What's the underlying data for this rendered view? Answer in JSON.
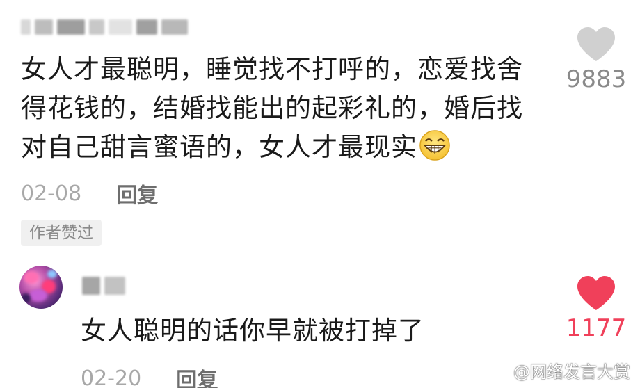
{
  "comments": [
    {
      "text": "女人才最聪明，睡觉找不打呼的，恋爱找舍\n得花钱的，结婚找能出的起彩礼的，婚后找\n对自己甜言蜜语的，女人才最现实",
      "emoji": "grinning-face-emoji",
      "date": "02-08",
      "reply_label": "回复",
      "badge": "作者赞过",
      "likes": "9883",
      "liked": false
    },
    {
      "text": "女人聪明的话你早就被打掉了",
      "date": "02-20",
      "reply_label": "回复",
      "likes": "1177",
      "liked": true
    }
  ],
  "watermark": "@网络发言大赏",
  "colors": {
    "liked": "#f0405a",
    "unliked": "#d0d0d0",
    "text": "#1a1a1a",
    "meta": "#a8a8a8"
  },
  "icons": [
    "heart-outline-icon",
    "heart-filled-icon",
    "weibo-icon"
  ]
}
